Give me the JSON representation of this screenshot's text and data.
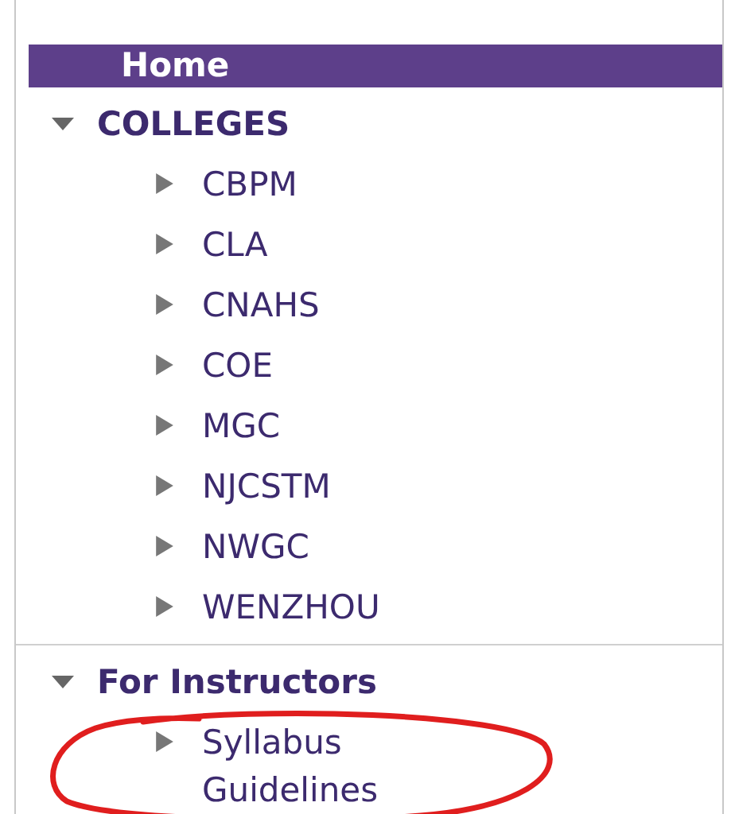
{
  "nav": {
    "home": {
      "label": "Home",
      "selected": true
    },
    "sections": [
      {
        "label": "COLLEGES",
        "expanded": true,
        "children": [
          {
            "label": "CBPM",
            "expanded": false,
            "circled": false
          },
          {
            "label": "CLA",
            "expanded": false,
            "circled": false
          },
          {
            "label": "CNAHS",
            "expanded": false,
            "circled": false
          },
          {
            "label": "COE",
            "expanded": false,
            "circled": false
          },
          {
            "label": "MGC",
            "expanded": false,
            "circled": false
          },
          {
            "label": "NJCSTM",
            "expanded": false,
            "circled": false
          },
          {
            "label": "NWGC",
            "expanded": false,
            "circled": false
          },
          {
            "label": "WENZHOU",
            "expanded": false,
            "circled": false
          }
        ]
      },
      {
        "label": "For Instructors",
        "expanded": true,
        "children": [
          {
            "label": "Syllabus Guidelines",
            "expanded": false,
            "circled": true
          }
        ]
      }
    ]
  }
}
